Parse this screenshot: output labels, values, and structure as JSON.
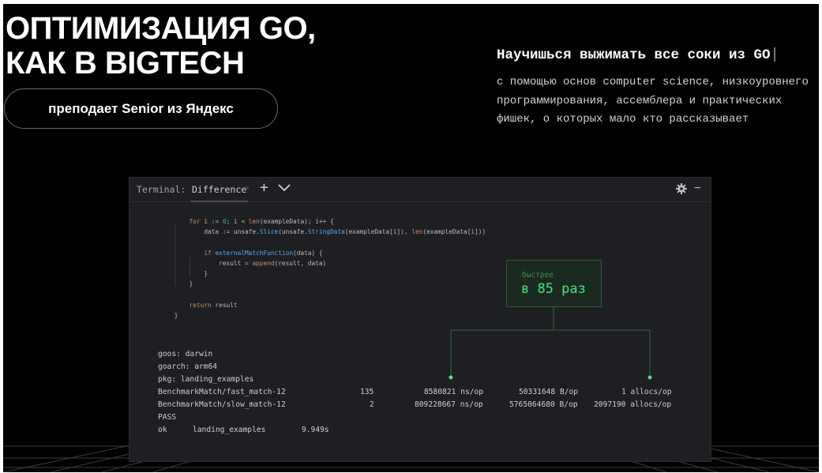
{
  "hero": {
    "title_line1": "ОПТИМИЗАЦИЯ GO,",
    "title_line2": "КАК В BIGTECH",
    "pill": "преподает Senior из Яндекс"
  },
  "tagline": "Научишься выжимать все соки из GO",
  "description": [
    "с помощью основ computer science, низкоуровнего",
    "программирования, ассемблера и практических",
    "фишек, о которых мало кто рассказывает"
  ],
  "terminal": {
    "label": "Terminal:",
    "tab": "Difference",
    "tab_close": "×",
    "plus": "+",
    "minimize": "−",
    "icons": [
      "chevron-down-icon",
      "gear-icon"
    ]
  },
  "code": {
    "l1": [
      "for",
      "i := ",
      "0",
      "; i < ",
      "len",
      "(exampleData); i++ {"
    ],
    "l2": [
      "data := unsafe.",
      "Slice",
      "(unsafe.",
      "StringData",
      "(exampleData[i]), ",
      "len",
      "(exampleData[i]))"
    ],
    "l3": [
      "if ",
      "externalMatchFunction",
      "(data) {"
    ],
    "l4": [
      "result = ",
      "append",
      "(result, data)"
    ],
    "l5": "}",
    "l6": "}",
    "l7": [
      "return",
      " result"
    ],
    "l8": "}"
  },
  "callout": {
    "small": "быстрее",
    "big": "в 85 раз"
  },
  "output": {
    "goos": "goos: darwin",
    "goarch": "goarch: arm64",
    "pkg": "pkg: landing_examples",
    "bench": [
      {
        "name": "BenchmarkMatch/fast_match-12",
        "n": "135",
        "ns": "8580821 ns/op",
        "bytes": "50331648 B/op",
        "allocs": "1 allocs/op"
      },
      {
        "name": "BenchmarkMatch/slow_match-12",
        "n": "2",
        "ns": "809228667 ns/op",
        "bytes": "5765064680 B/op",
        "allocs": "2097190 allocs/op"
      }
    ],
    "pass": "PASS",
    "ok": "ok",
    "ok_pkg": "landing_examples",
    "ok_time": "9.949s"
  },
  "colors": {
    "background": "#000000",
    "terminal_bg": "#1e1f22",
    "accent_green": "#4fe07b",
    "keyword": "#cf8e6d",
    "function": "#56a8f5",
    "number": "#2aacb8"
  }
}
